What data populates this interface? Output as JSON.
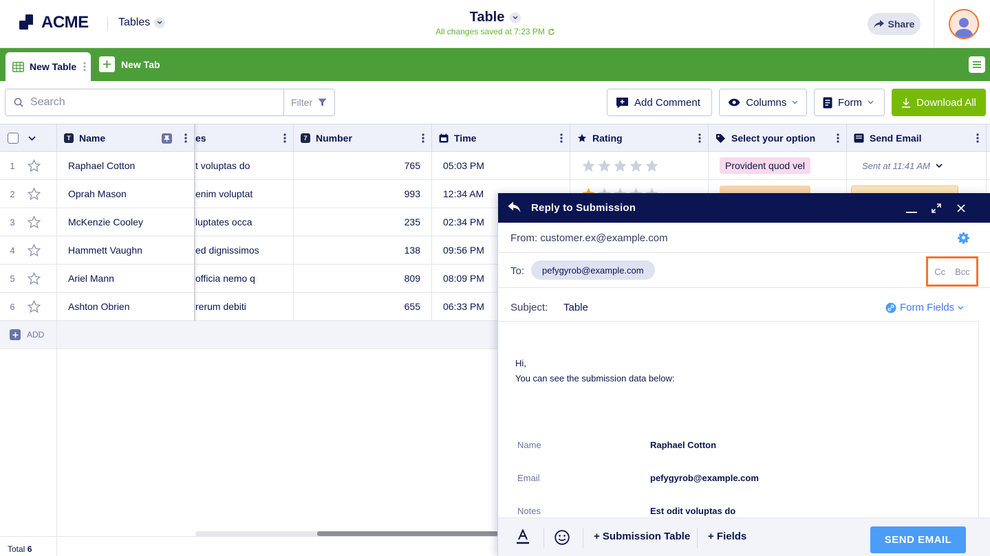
{
  "header": {
    "logo_text": "ACME",
    "tables_menu": "Tables",
    "doc_title": "Table",
    "save_status": "All changes saved at 7:23 PM",
    "share_label": "Share"
  },
  "tabs": {
    "active": "New Table",
    "new_tab": "New Tab"
  },
  "toolbar": {
    "search_placeholder": "Search",
    "filter_label": "Filter",
    "add_comment": "Add Comment",
    "columns": "Columns",
    "form": "Form",
    "download_all": "Download All"
  },
  "grid": {
    "columns": [
      "Name",
      "es",
      "Number",
      "Time",
      "Rating",
      "Select your option",
      "Send Email"
    ],
    "rows": [
      {
        "num": "1",
        "name": "Raphael Cotton",
        "notes": "t voluptas do",
        "number": "765",
        "time": "05:03 PM",
        "rating": 0,
        "option": "Provident quod vel",
        "email": "Sent at 11:41 AM"
      },
      {
        "num": "2",
        "name": "Oprah Mason",
        "notes": "enim voluptat",
        "number": "993",
        "time": "12:34 AM",
        "rating": 1,
        "option": "",
        "email": ""
      },
      {
        "num": "3",
        "name": "McKenzie Cooley",
        "notes": "luptates occa",
        "number": "235",
        "time": "02:34 PM",
        "rating": 0,
        "option": "",
        "email": ""
      },
      {
        "num": "4",
        "name": "Hammett Vaughn",
        "notes": "ed dignissimos",
        "number": "138",
        "time": "09:56 PM",
        "rating": 0,
        "option": "",
        "email": ""
      },
      {
        "num": "5",
        "name": "Ariel Mann",
        "notes": "officia nemo q",
        "number": "809",
        "time": "08:09 PM",
        "rating": 0,
        "option": "",
        "email": ""
      },
      {
        "num": "6",
        "name": "Ashton Obrien",
        "notes": "rerum debiti",
        "number": "655",
        "time": "06:33 PM",
        "rating": 0,
        "option": "",
        "email": ""
      }
    ],
    "add_label": "ADD",
    "total_label": "Total",
    "total_count": "6"
  },
  "modal": {
    "title": "Reply to Submission",
    "from": "From: customer.ex@example.com",
    "to_label": "To:",
    "to_chip": "pefygyrob@example.com",
    "cc": "Cc",
    "bcc": "Bcc",
    "subject_label": "Subject:",
    "subject_value": "Table",
    "form_fields": "Form Fields",
    "greeting": "Hi,",
    "intro": "You can see the submission data below:",
    "submission": [
      {
        "label": "Name",
        "value": "Raphael Cotton"
      },
      {
        "label": "Email",
        "value": "pefygyrob@example.com"
      },
      {
        "label": "Notes",
        "value": "Est odit voluptas do"
      }
    ],
    "submission_table": "+ Submission Table",
    "fields": "+ Fields",
    "send": "SEND EMAIL"
  },
  "colors": {
    "brand_green": "#4c9f38",
    "download_green": "#78bb07",
    "navy": "#0a1551",
    "highlight_orange": "#ef7633",
    "send_blue": "#4b9df8",
    "chip_pink": "#f9d9ec",
    "chip_orange": "#fbd5a8"
  }
}
